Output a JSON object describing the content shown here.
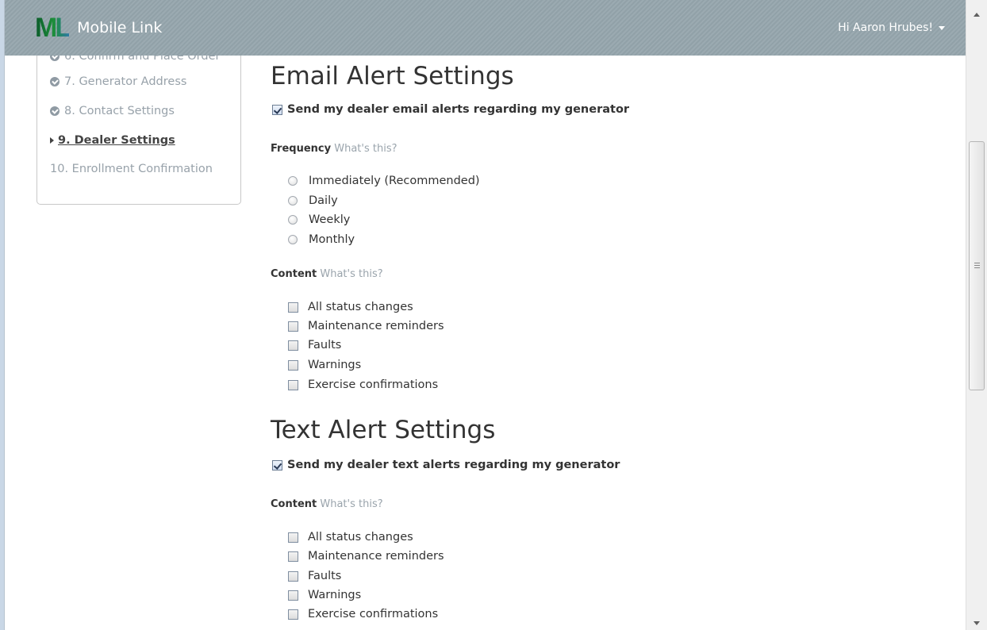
{
  "header": {
    "logo_text": "ML",
    "brand_name": "Mobile Link",
    "user_greeting": "Hi Aaron Hrubes!"
  },
  "sidebar": {
    "items": [
      {
        "label": "6. Confirm and Place Order",
        "status": "complete"
      },
      {
        "label": "7. Generator Address",
        "status": "complete"
      },
      {
        "label": "8. Contact Settings",
        "status": "complete"
      },
      {
        "label": "9. Dealer Settings",
        "status": "active"
      },
      {
        "label": "10. Enrollment Confirmation",
        "status": "pending"
      }
    ]
  },
  "email": {
    "title": "Email Alert Settings",
    "opt_in_label": "Send my dealer email alerts regarding my generator",
    "opt_in_checked": true,
    "frequency_label": "Frequency",
    "frequency_help": "What's this?",
    "frequency_options": [
      "Immediately (Recommended)",
      "Daily",
      "Weekly",
      "Monthly"
    ],
    "content_label": "Content",
    "content_help": "What's this?",
    "content_options": [
      "All status changes",
      "Maintenance reminders",
      "Faults",
      "Warnings",
      "Exercise confirmations"
    ]
  },
  "text": {
    "title": "Text Alert Settings",
    "opt_in_label": "Send my dealer text alerts regarding my generator",
    "opt_in_checked": true,
    "content_label": "Content",
    "content_help": "What's this?",
    "content_options": [
      "All status changes",
      "Maintenance reminders",
      "Faults",
      "Warnings",
      "Exercise confirmations"
    ]
  },
  "colors": {
    "navbar": "#96a6ad",
    "muted_text": "#9aa4ac"
  }
}
